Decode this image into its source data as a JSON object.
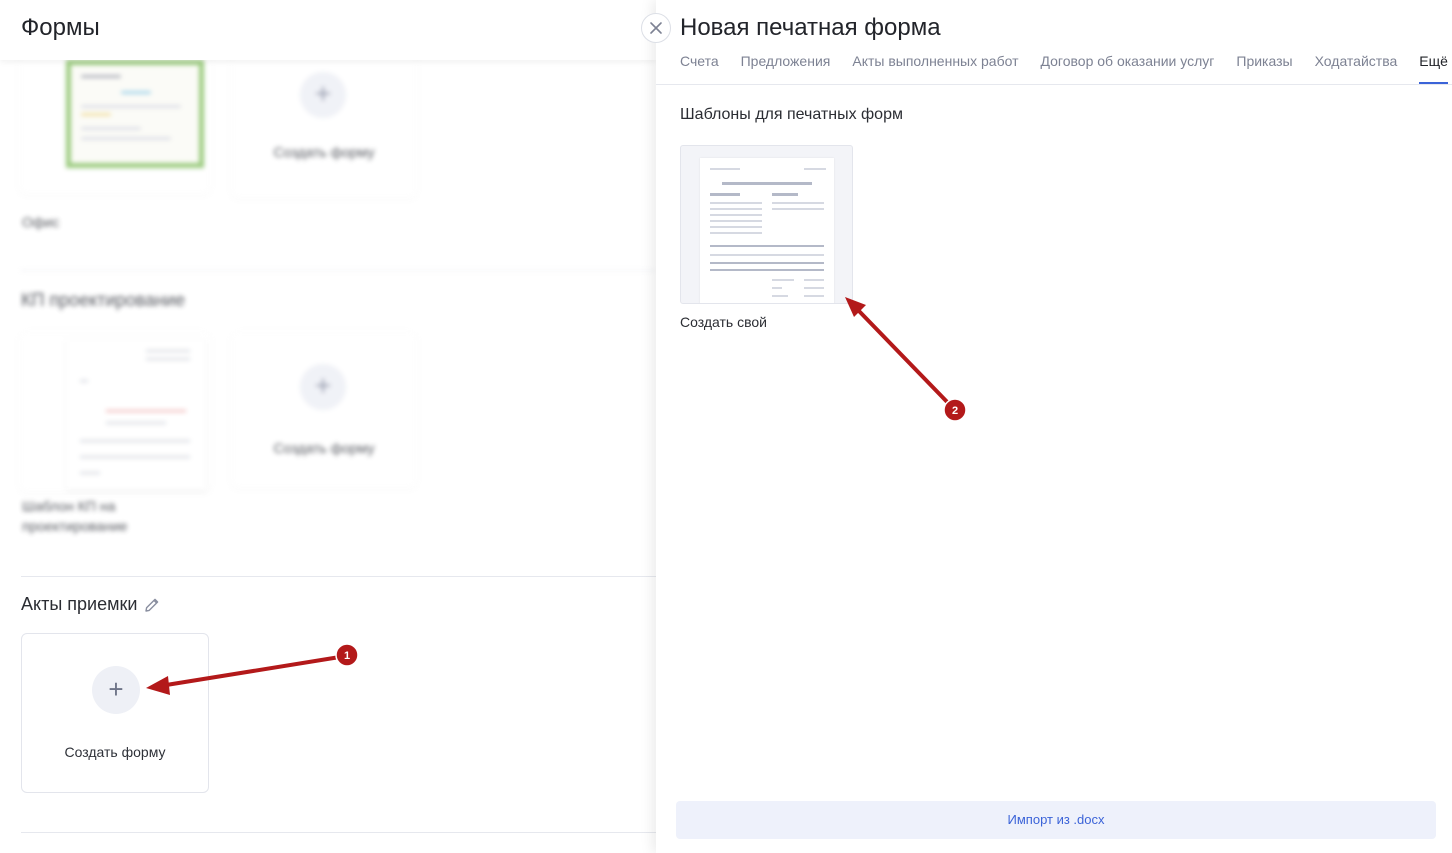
{
  "left_page": {
    "title": "Формы",
    "blurred": {
      "card_create_label_1": "Создать форму",
      "card_label_1": "Офис",
      "section_heading": "КП проектирование",
      "card_create_label_2": "Создать форму",
      "card_label_2_line1": "Шаблон КП на",
      "card_label_2_line2": "проектирование"
    },
    "section": {
      "title": "Акты приемки",
      "create_label": "Создать форму",
      "create_plus": "+"
    }
  },
  "drawer": {
    "title": "Новая печатная форма",
    "tabs": [
      {
        "label": "Счета",
        "active": false
      },
      {
        "label": "Предложения",
        "active": false
      },
      {
        "label": "Акты выполненных работ",
        "active": false
      },
      {
        "label": "Договор об оказании услуг",
        "active": false
      },
      {
        "label": "Приказы",
        "active": false
      },
      {
        "label": "Ходатайства",
        "active": false
      },
      {
        "label": "Ещё",
        "active": true
      }
    ],
    "templates_title": "Шаблоны для печатных форм",
    "template_label": "Создать свой",
    "import_button": "Импорт из .docx"
  },
  "annotations": {
    "marker_1": "1",
    "marker_2": "2",
    "color": "#b3191a"
  },
  "colors": {
    "accent": "#3b63d8",
    "import_bg": "#eef1fb",
    "annotation": "#b3191a"
  }
}
